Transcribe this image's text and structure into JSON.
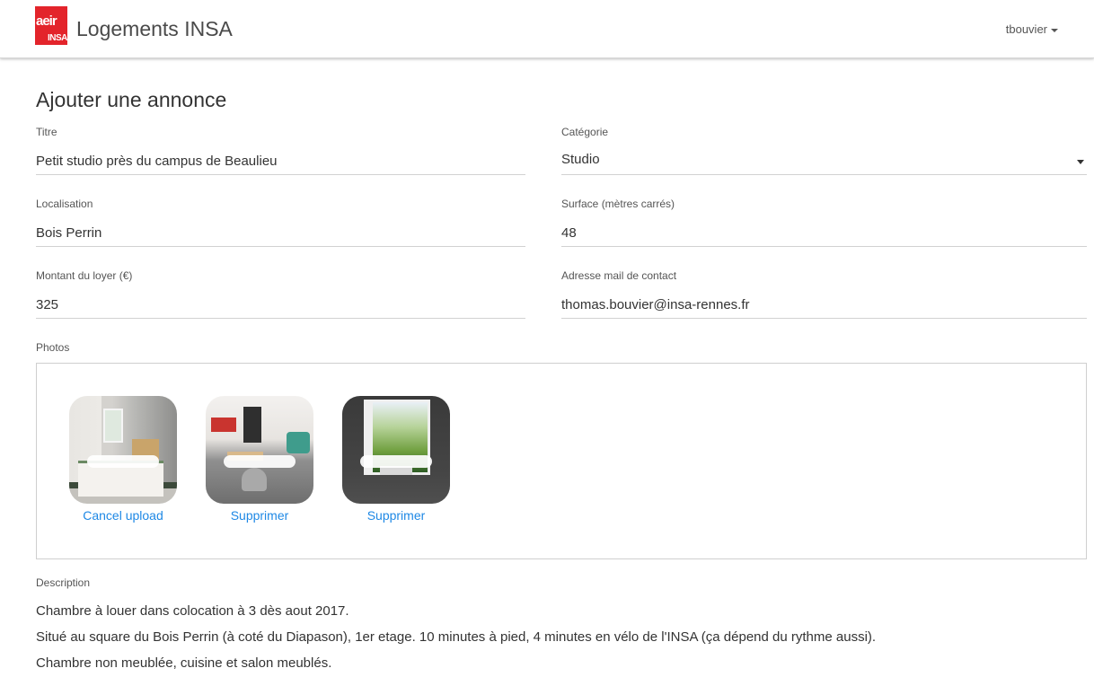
{
  "navbar": {
    "logo_top": "aeir",
    "logo_bottom": "INSA",
    "brand": "Logements INSA",
    "user": "tbouvier",
    "accent_color": "#e3242b"
  },
  "form": {
    "title": "Ajouter une annonce",
    "titre": {
      "label": "Titre",
      "value": "Petit studio près du campus de Beaulieu"
    },
    "categorie": {
      "label": "Catégorie",
      "value": "Studio"
    },
    "localisation": {
      "label": "Localisation",
      "value": "Bois Perrin"
    },
    "surface": {
      "label": "Surface (mètres carrés)",
      "value": "48"
    },
    "loyer": {
      "label": "Montant du loyer (€)",
      "value": "325"
    },
    "email": {
      "label": "Adresse mail de contact",
      "value": "thomas.bouvier@insa-rennes.fr"
    },
    "photos": {
      "label": "Photos",
      "items": [
        {
          "action": "Cancel upload",
          "icon": "bedroom-photo",
          "upload_in_progress": true
        },
        {
          "action": "Supprimer",
          "icon": "living-room-photo"
        },
        {
          "action": "Supprimer",
          "icon": "window-view-photo"
        }
      ],
      "link_color": "#1e88e5"
    },
    "description": {
      "label": "Description",
      "lines": [
        "Chambre à louer dans colocation à 3 dès aout 2017.",
        "Situé au square du Bois Perrin (à coté du Diapason), 1er etage. 10 minutes à pied, 4 minutes en vélo de l'INSA (ça dépend du rythme aussi).",
        "Chambre non meublée, cuisine et salon meublés."
      ]
    }
  }
}
